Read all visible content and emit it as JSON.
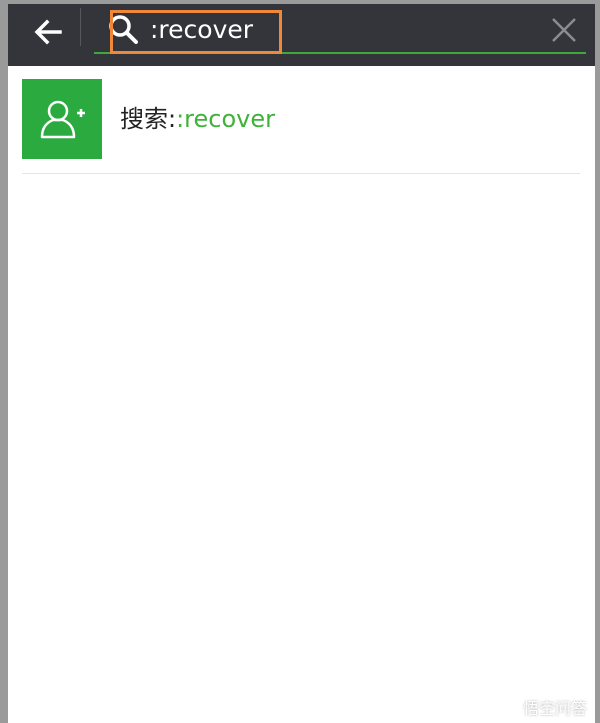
{
  "search": {
    "query": ":recover",
    "icon": "search-icon"
  },
  "result": {
    "prefix": "搜索:",
    "query": ":recover",
    "avatar_icon": "add-person-icon"
  },
  "watermark": {
    "text": "悟空问答",
    "icon": "speech-bubble-icon"
  },
  "colors": {
    "topbar": "#33353a",
    "accent_green": "#3fb23a",
    "avatar_green": "#2baa40",
    "highlight_orange": "#f0883a"
  }
}
